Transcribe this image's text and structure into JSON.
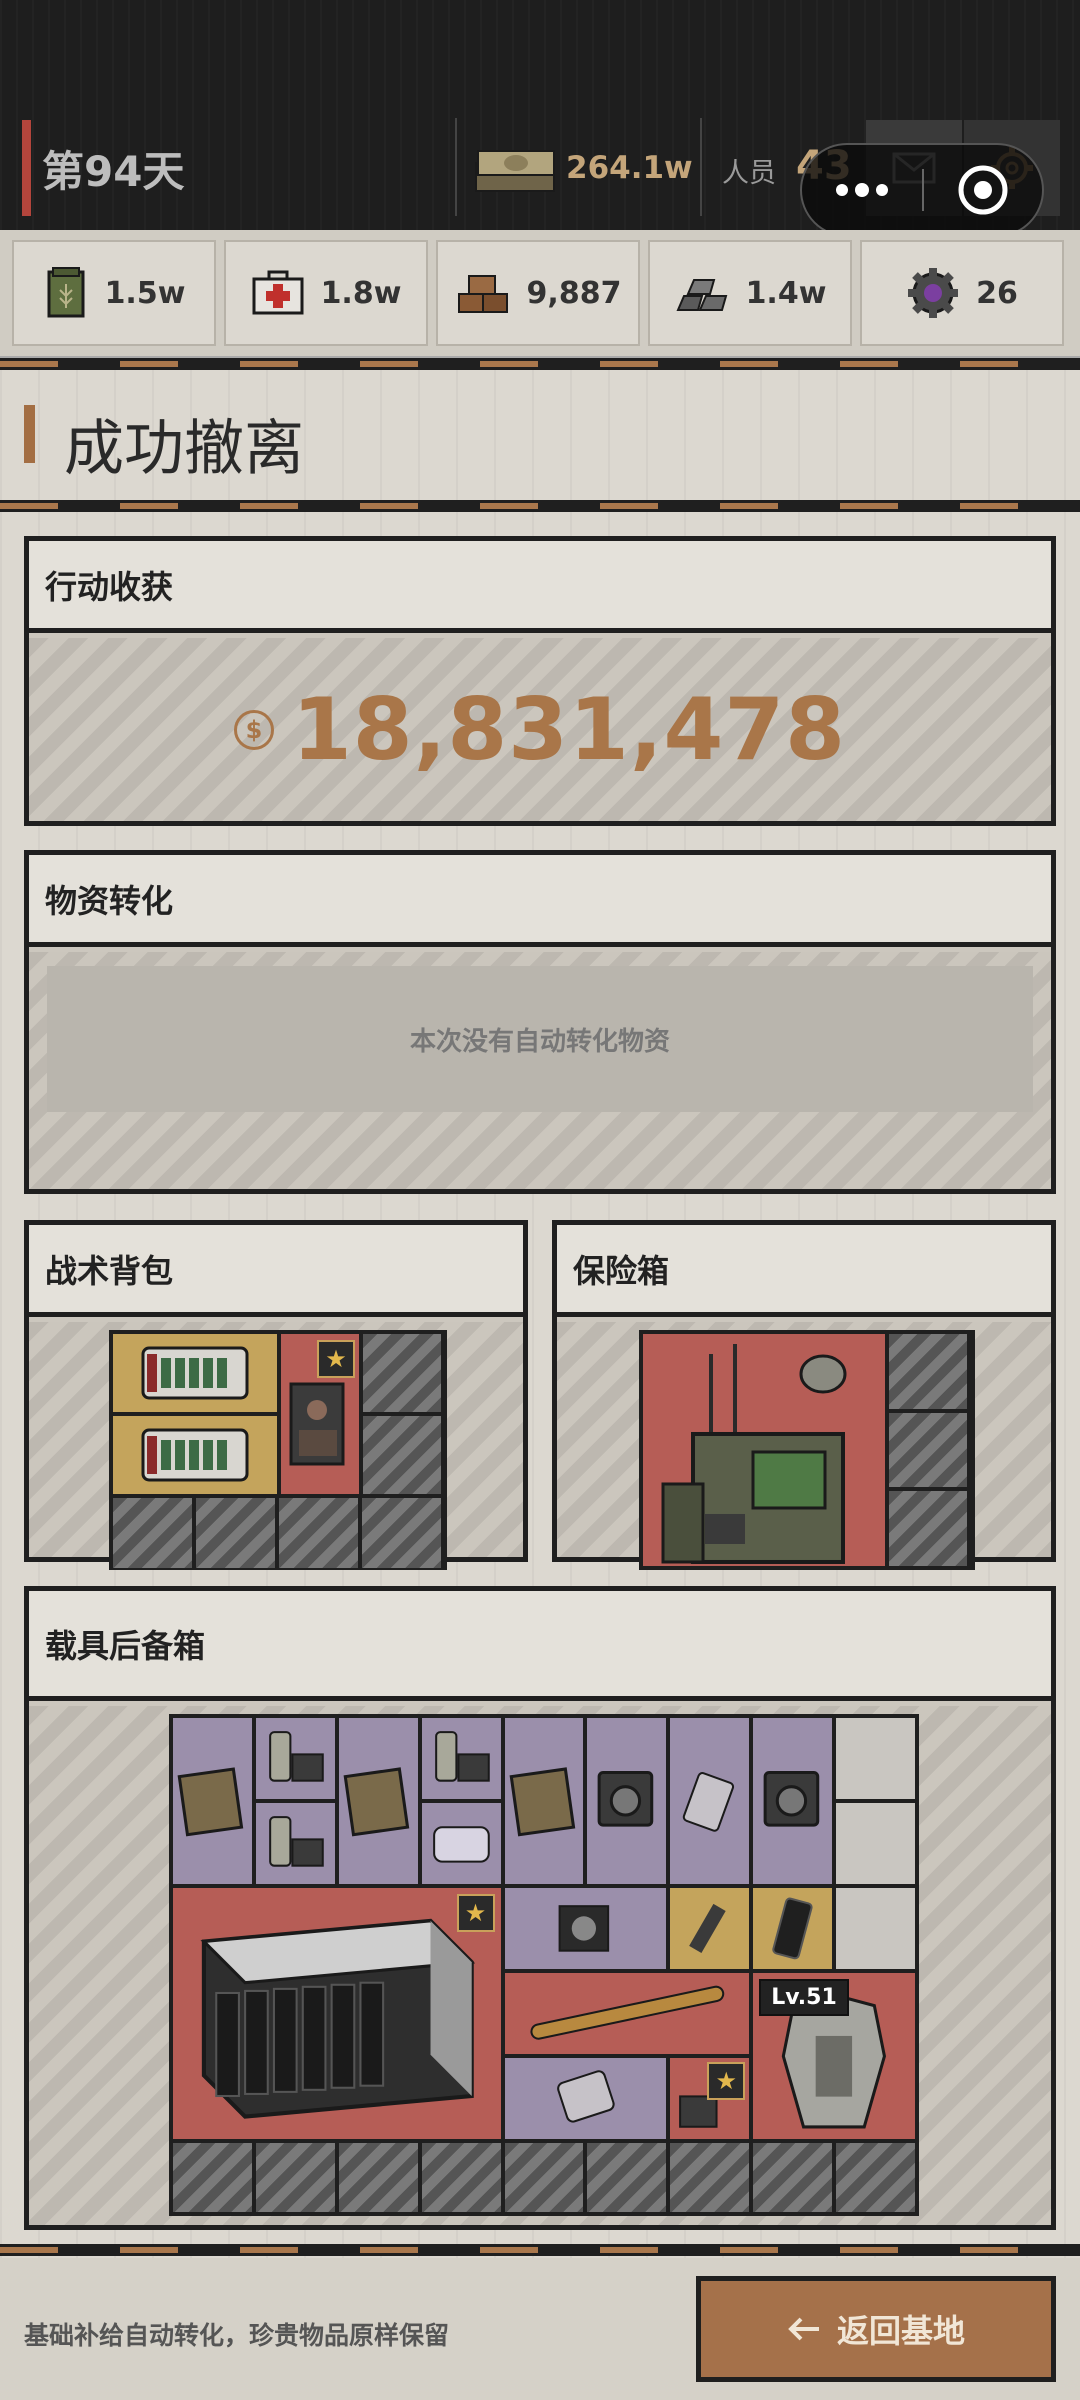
{
  "header": {
    "day": "第94天",
    "cash": "264.1w",
    "staff_label": "人员",
    "staff_count": "43"
  },
  "resources": [
    {
      "icon": "grain-sack-icon",
      "value": "1.5w"
    },
    {
      "icon": "medkit-icon",
      "value": "1.8w"
    },
    {
      "icon": "wood-planks-icon",
      "value": "9,887"
    },
    {
      "icon": "metal-ingots-icon",
      "value": "1.4w"
    },
    {
      "icon": "gear-part-icon",
      "value": "26"
    }
  ],
  "page": {
    "title": "成功撤离"
  },
  "earnings": {
    "title": "行动收获",
    "value": "18,831,478"
  },
  "conversion": {
    "title": "物资转化",
    "empty_text": "本次没有自动转化物资"
  },
  "backpack": {
    "title": "战术背包"
  },
  "safebox": {
    "title": "保险箱"
  },
  "trunk": {
    "title": "载具后备箱",
    "armor_level": "Lv.51"
  },
  "footer": {
    "note": "基础补给自动转化，珍贵物品原样保留",
    "back_label": "返回基地"
  },
  "colors": {
    "accent": "#a97649",
    "danger_accent": "#b3453c",
    "slot_purple": "#9b8fab",
    "slot_gold": "#c4a45c",
    "slot_red": "#b65d56"
  }
}
